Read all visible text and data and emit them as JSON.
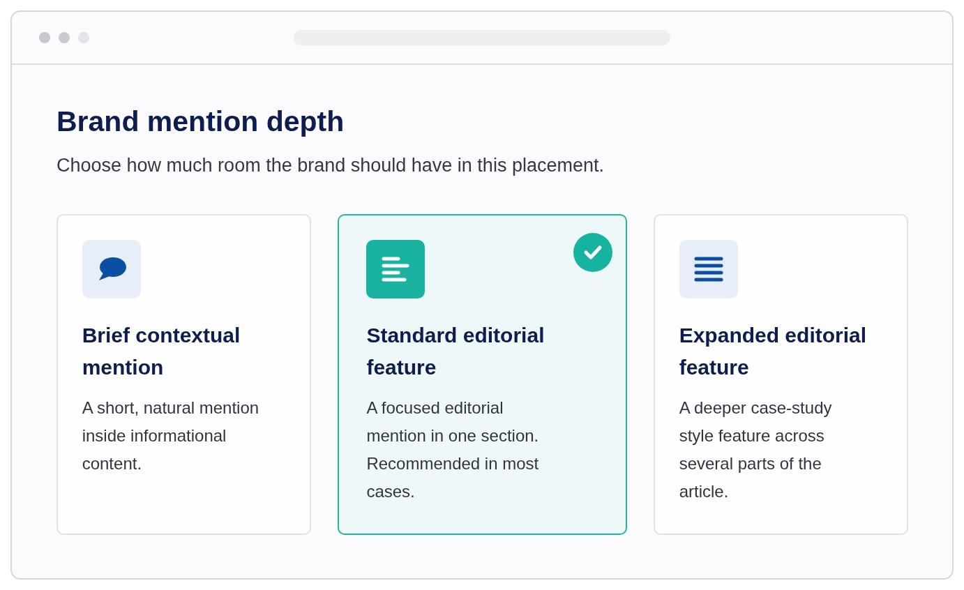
{
  "heading": "Brand mention depth",
  "subheading": "Choose how much room the brand should have in this placement.",
  "options": [
    {
      "kind": "speech",
      "title": "Brief contextual mention",
      "description": "A short, natural mention inside informational content.",
      "selected": false
    },
    {
      "kind": "text",
      "title": "Standard editorial feature",
      "description": "A focused editorial mention in one section. Recommended in most cases.",
      "selected": true
    },
    {
      "kind": "list",
      "title": "Expanded editorial feature",
      "description": "A deeper case-study style feature across several parts of the article.",
      "selected": false
    }
  ]
}
